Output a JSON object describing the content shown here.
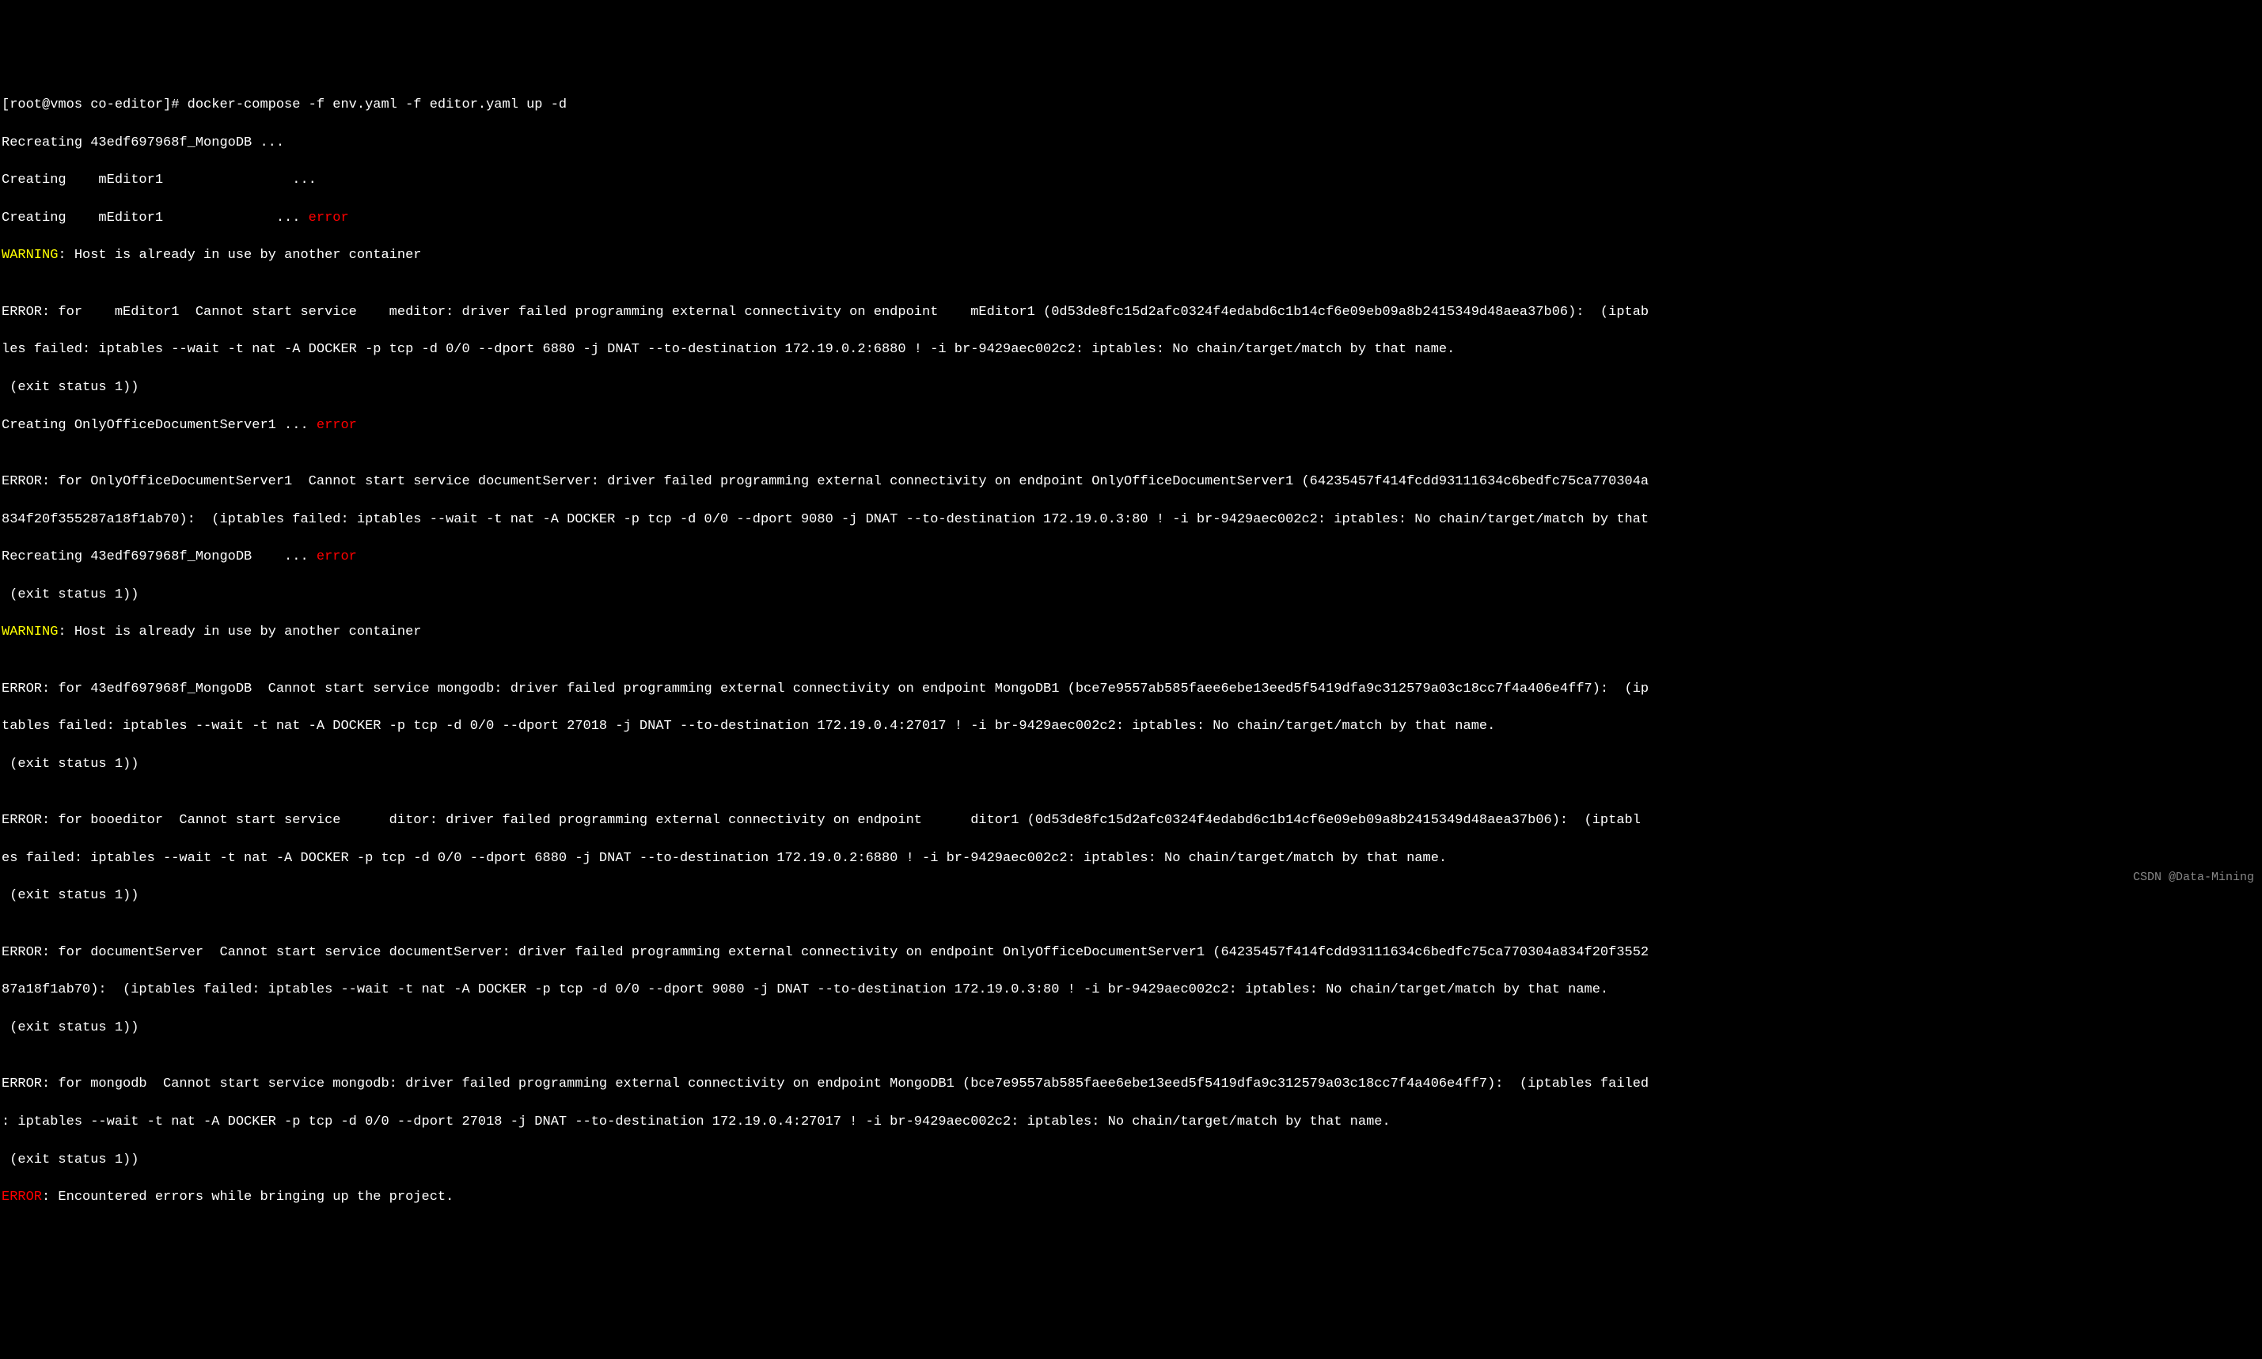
{
  "prompt": "[root@vmos co-editor]# ",
  "command": "docker-compose -f env.yaml -f editor.yaml up -d",
  "lines": {
    "recreating_mongo": "Recreating 43edf697968f_MongoDB ...",
    "creating_editor1": "Creating    mEditor1                ...",
    "creating_editor1_error": "Creating    mEditor1              ... ",
    "error_label": "error",
    "warning_label": "WARNING",
    "error_label_caps": "ERROR",
    "warning_host": ": Host is already in use by another container",
    "empty": "",
    "error_editor1_p1": "ERROR: for    mEditor1  Cannot start service    meditor: driver failed programming external connectivity on endpoint    mEditor1 (0d53de8fc15d2afc0324f4edabd6c1b14cf6e09eb09a8b2415349d48aea37b06):  (iptab",
    "error_editor1_p2": "les failed: iptables --wait -t nat -A DOCKER -p tcp -d 0/0 --dport 6880 -j DNAT --to-destination 172.19.0.2:6880 ! -i br-9429aec002c2: iptables: No chain/target/match by that name.",
    "exit_status": " (exit status 1))",
    "creating_onlyoffice": "Creating OnlyOfficeDocumentServer1 ... ",
    "error_onlyoffice_p1": "ERROR: for OnlyOfficeDocumentServer1  Cannot start service documentServer: driver failed programming external connectivity on endpoint OnlyOfficeDocumentServer1 (64235457f414fcdd93111634c6bedfc75ca770304a",
    "error_onlyoffice_p2": "834f20f355287a18f1ab70):  (iptables failed: iptables --wait -t nat -A DOCKER -p tcp -d 0/0 --dport 9080 -j DNAT --to-destination 172.19.0.3:80 ! -i br-9429aec002c2: iptables: No chain/target/match by that",
    "recreating_mongo_error": "Recreating 43edf697968f_MongoDB    ... ",
    "error_mongo_p1": "ERROR: for 43edf697968f_MongoDB  Cannot start service mongodb: driver failed programming external connectivity on endpoint MongoDB1 (bce7e9557ab585faee6ebe13eed5f5419dfa9c312579a03c18cc7f4a406e4ff7):  (ip",
    "error_mongo_p2": "tables failed: iptables --wait -t nat -A DOCKER -p tcp -d 0/0 --dport 27018 -j DNAT --to-destination 172.19.0.4:27017 ! -i br-9429aec002c2: iptables: No chain/target/match by that name.",
    "error_booeditor_p1": "ERROR: for booeditor  Cannot start service      ditor: driver failed programming external connectivity on endpoint      ditor1 (0d53de8fc15d2afc0324f4edabd6c1b14cf6e09eb09a8b2415349d48aea37b06):  (iptabl",
    "error_booeditor_p2": "es failed: iptables --wait -t nat -A DOCKER -p tcp -d 0/0 --dport 6880 -j DNAT --to-destination 172.19.0.2:6880 ! -i br-9429aec002c2: iptables: No chain/target/match by that name.",
    "error_docserver_p1": "ERROR: for documentServer  Cannot start service documentServer: driver failed programming external connectivity on endpoint OnlyOfficeDocumentServer1 (64235457f414fcdd93111634c6bedfc75ca770304a834f20f3552",
    "error_docserver_p2": "87a18f1ab70):  (iptables failed: iptables --wait -t nat -A DOCKER -p tcp -d 0/0 --dport 9080 -j DNAT --to-destination 172.19.0.3:80 ! -i br-9429aec002c2: iptables: No chain/target/match by that name.",
    "error_mongodb_p1": "ERROR: for mongodb  Cannot start service mongodb: driver failed programming external connectivity on endpoint MongoDB1 (bce7e9557ab585faee6ebe13eed5f5419dfa9c312579a03c18cc7f4a406e4ff7):  (iptables failed",
    "error_mongodb_p2": ": iptables --wait -t nat -A DOCKER -p tcp -d 0/0 --dport 27018 -j DNAT --to-destination 172.19.0.4:27017 ! -i br-9429aec002c2: iptables: No chain/target/match by that name.",
    "final_error": ": Encountered errors while bringing up the project."
  },
  "watermark": "CSDN @Data-Mining"
}
